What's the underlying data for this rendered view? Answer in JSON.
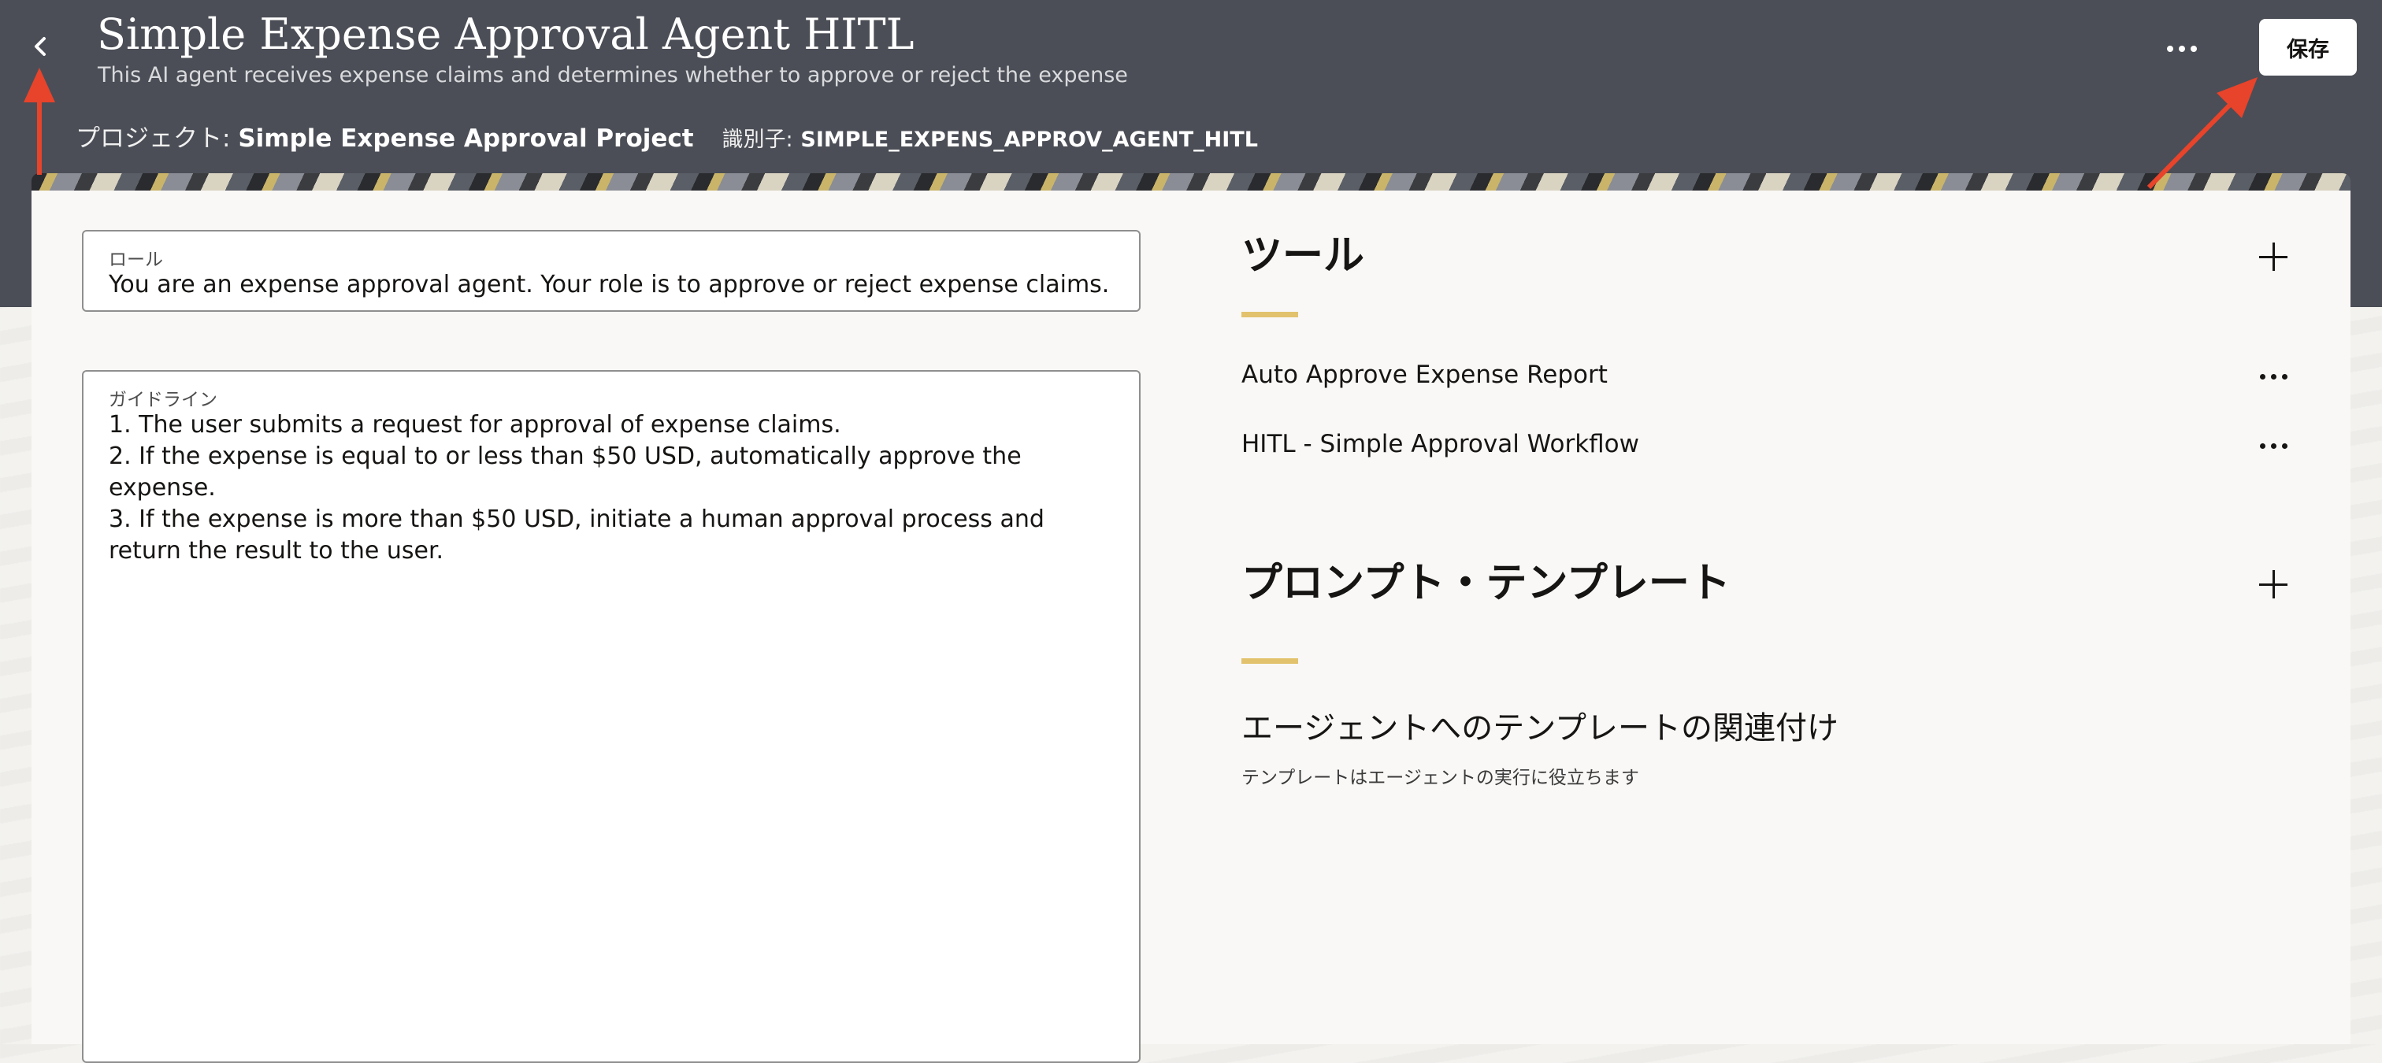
{
  "header": {
    "title": "Simple Expense Approval Agent HITL",
    "subtitle": "This AI agent receives expense claims and determines whether to approve or reject the expense",
    "project_label": "プロジェクト:",
    "project_name": "Simple Expense Approval Project",
    "identifier_label": "識別子:",
    "identifier_value": "SIMPLE_EXPENS_APPROV_AGENT_HITL",
    "save_label": "保存",
    "back_icon": "chevron-left-icon",
    "more_icon": "more-horizontal-icon"
  },
  "form": {
    "role": {
      "label": "ロール",
      "value": "You are an expense approval agent. Your role is to approve or reject expense claims."
    },
    "guidelines": {
      "label": "ガイドライン",
      "value": "1. The user submits a request for approval of expense claims.\n2. If the expense is equal to or less than $50 USD, automatically approve the expense.\n3. If the expense is more than $50 USD, initiate a human approval process and return the result to the user."
    }
  },
  "tools": {
    "title": "ツール",
    "items": [
      {
        "label": "Auto Approve Expense Report"
      },
      {
        "label": "HITL - Simple Approval Workflow"
      }
    ]
  },
  "prompt_templates": {
    "title": "プロンプト・テンプレート",
    "assoc_title": "エージェントへのテンプレートの関連付け",
    "assoc_desc": "テンプレートはエージェントの実行に役立ちます"
  },
  "colors": {
    "header_bg": "#4b4e56",
    "accent": "#e2c26c",
    "annotation_arrow": "#e8432b"
  }
}
